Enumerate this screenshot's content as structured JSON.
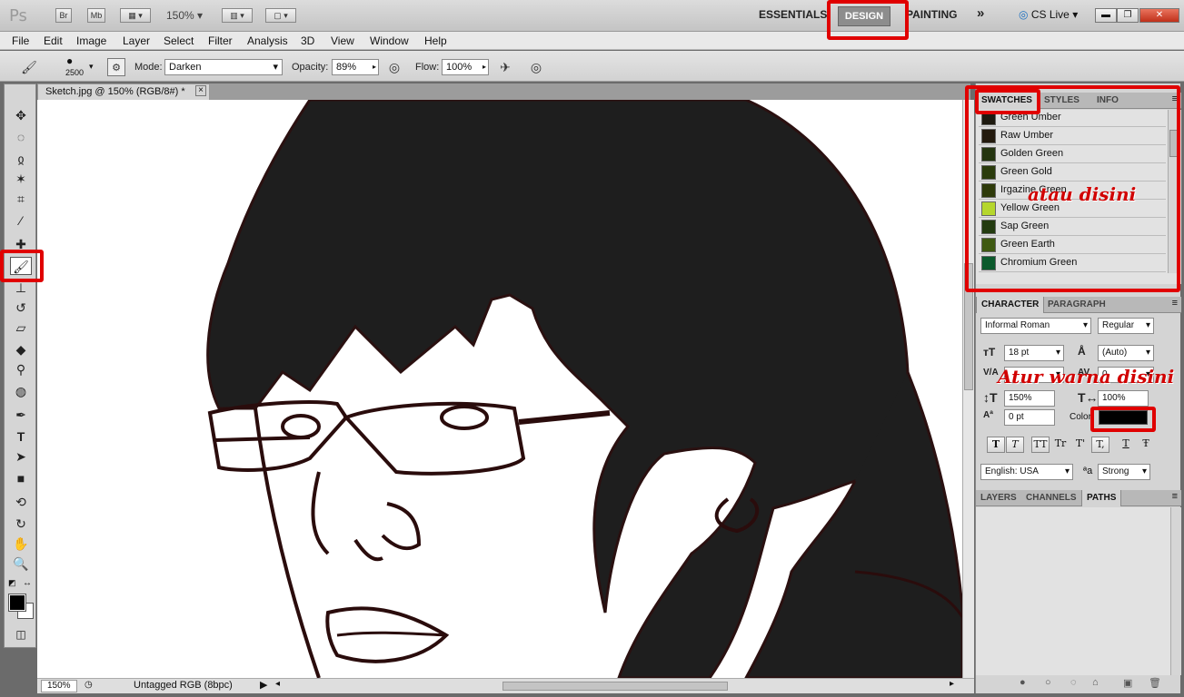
{
  "app": {
    "logo": "Ps",
    "bridge_label": "Br",
    "minibridge_label": "Mb",
    "zoom": "150%",
    "workspaces": [
      "ESSENTIALS",
      "DESIGN",
      "PAINTING"
    ],
    "more_label": "»",
    "cslive_label": "CS Live"
  },
  "menu": [
    "File",
    "Edit",
    "Image",
    "Layer",
    "Select",
    "Filter",
    "Analysis",
    "3D",
    "View",
    "Window",
    "Help"
  ],
  "options": {
    "brush_size": "2500",
    "mode_label": "Mode:",
    "mode_value": "Darken",
    "opacity_label": "Opacity:",
    "opacity_value": "89%",
    "flow_label": "Flow:",
    "flow_value": "100%"
  },
  "document": {
    "tab_title": "Sketch.jpg @ 150% (RGB/8#) *",
    "close_icon": "×",
    "status_zoom": "150%",
    "status_profile": "Untagged RGB (8bpc)"
  },
  "swatches_panel": {
    "tabs": [
      "SWATCHES",
      "STYLES",
      "INFO"
    ],
    "items": [
      {
        "name": "Green Umber",
        "color": "#1e1a10"
      },
      {
        "name": "Raw Umber",
        "color": "#231a0e"
      },
      {
        "name": "Golden Green",
        "color": "#243510"
      },
      {
        "name": "Green Gold",
        "color": "#2a3b0c"
      },
      {
        "name": "Irgazine Green",
        "color": "#2e3a0a"
      },
      {
        "name": "Yellow Green",
        "color": "#b5d62c"
      },
      {
        "name": "Sap Green",
        "color": "#233b10"
      },
      {
        "name": "Green Earth",
        "color": "#3f5a12"
      },
      {
        "name": "Chromium Green",
        "color": "#0b5a2c"
      }
    ]
  },
  "character_panel": {
    "tabs": [
      "CHARACTER",
      "PARAGRAPH"
    ],
    "font_family": "Informal Roman",
    "font_style": "Regular",
    "font_size": "18 pt",
    "leading": "(Auto)",
    "kerning": "",
    "tracking": "0",
    "vertical_scale": "150%",
    "horizontal_scale": "100%",
    "baseline_shift": "0 pt",
    "color_label": "Color:",
    "color_value": "#000000",
    "style_buttons": [
      "T",
      "T",
      "TT",
      "Tr",
      "T'",
      "T,",
      "T",
      "Ŧ"
    ],
    "language": "English: USA",
    "antialias": "Strong"
  },
  "layers_panel": {
    "tabs": [
      "LAYERS",
      "CHANNELS",
      "PATHS"
    ]
  },
  "annotations": {
    "note_swatches": "atau disini",
    "note_color": "Atur warna disini"
  }
}
